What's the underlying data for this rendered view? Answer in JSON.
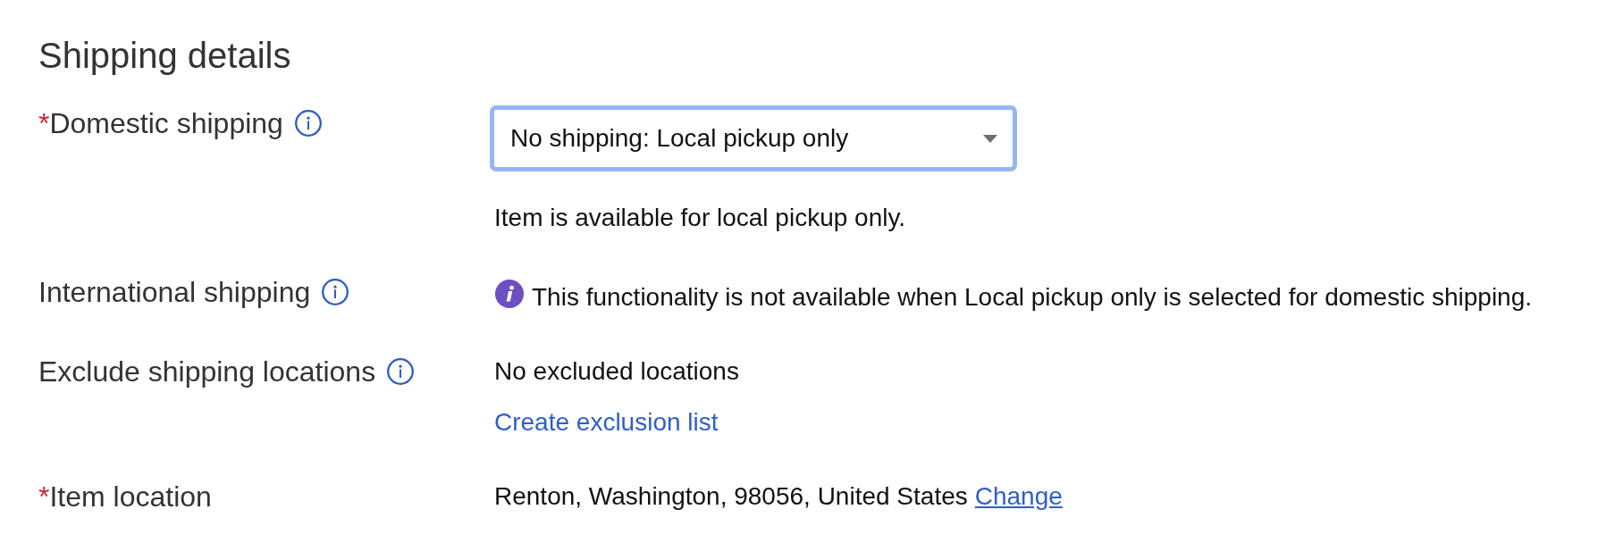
{
  "title": "Shipping details",
  "fields": [
    {
      "label": "Domestic shipping",
      "required_mark": "*",
      "info": true,
      "dropdown": {
        "value": "No shipping: Local pickup only",
        "focused": true
      },
      "helper": "Item is available for local pickup only."
    },
    {
      "label": "International shipping",
      "info": true,
      "notice": "This functionality is not available when Local pickup only is selected for domestic shipping."
    },
    {
      "label": "Exclude shipping locations",
      "info": true,
      "text": "No excluded locations",
      "link": {
        "text": "Create exclusion list",
        "inline": false
      }
    },
    {
      "label": "Item location",
      "required_mark": "*",
      "info": false,
      "text": "Renton, Washington, 98056, United States",
      "link": {
        "text": "Change",
        "inline": true
      }
    }
  ]
}
